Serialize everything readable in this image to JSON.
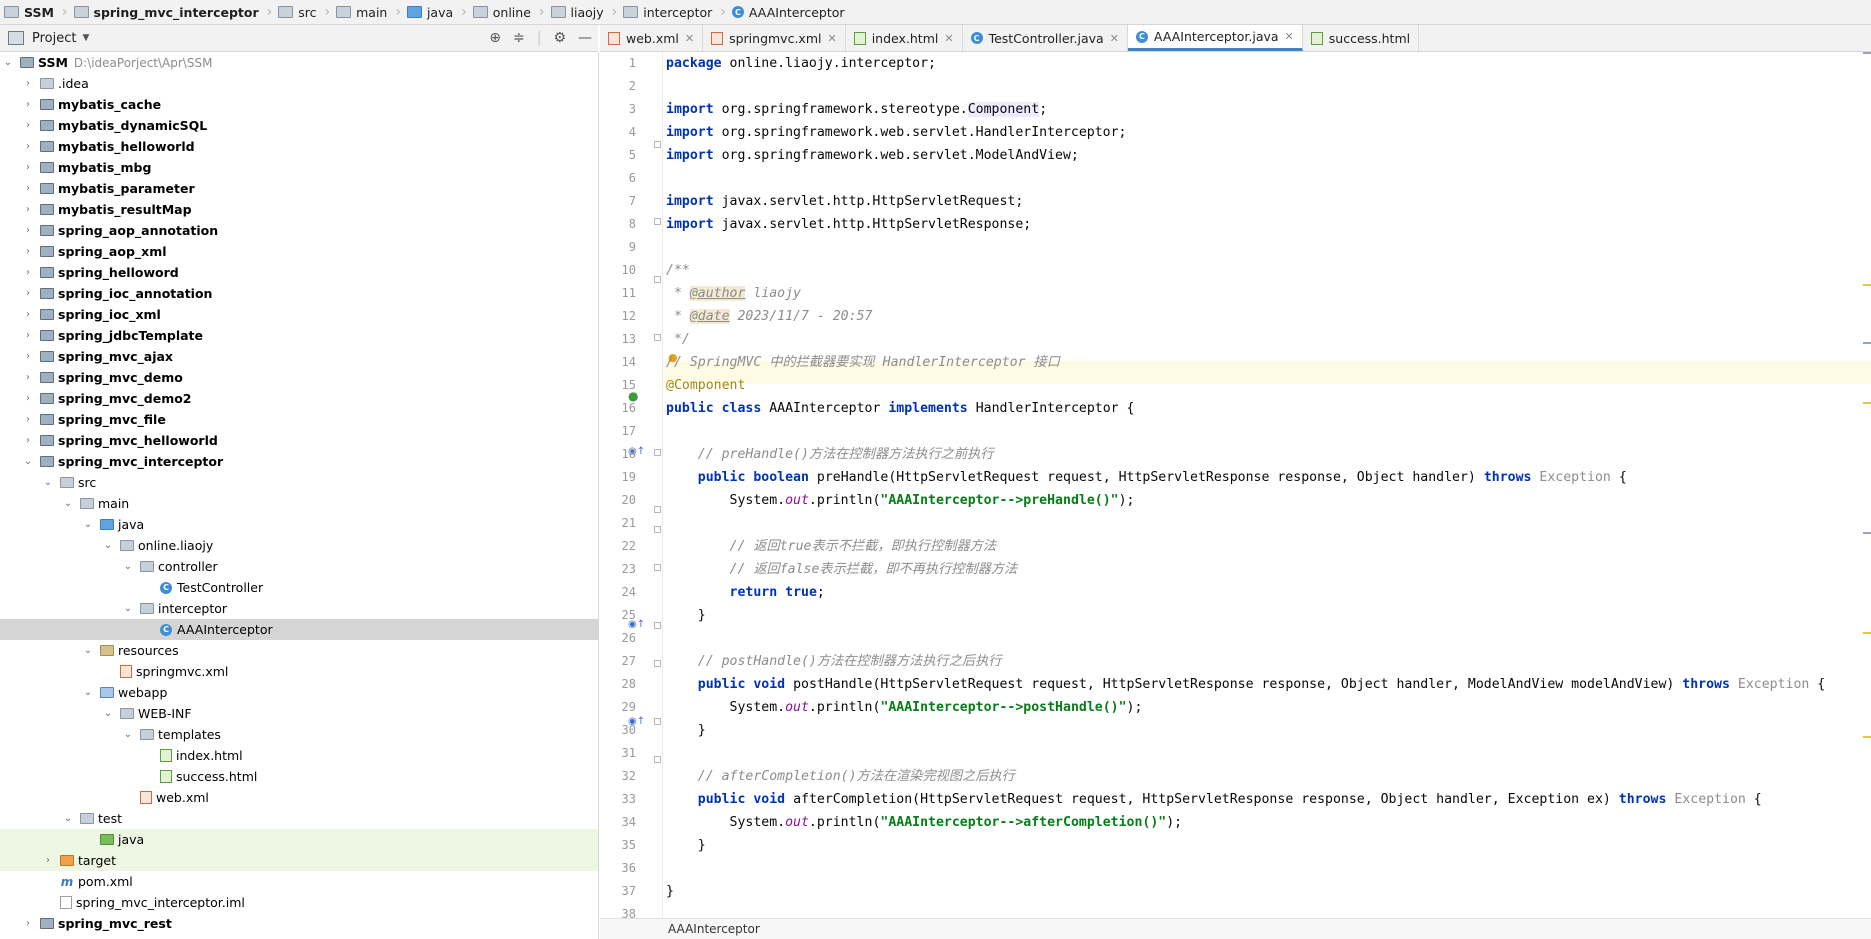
{
  "breadcrumb": [
    "SSM",
    "spring_mvc_interceptor",
    "src",
    "main",
    "java",
    "online",
    "liaojy",
    "interceptor",
    "AAAInterceptor"
  ],
  "project_panel": {
    "title": "Project",
    "root_name": "SSM",
    "root_path": "D:\\ideaPorject\\Apr\\SSM"
  },
  "tree": [
    {
      "label": ".idea",
      "bold": false
    },
    {
      "label": "mybatis_cache",
      "bold": true
    },
    {
      "label": "mybatis_dynamicSQL",
      "bold": true
    },
    {
      "label": "mybatis_helloworld",
      "bold": true
    },
    {
      "label": "mybatis_mbg",
      "bold": true
    },
    {
      "label": "mybatis_parameter",
      "bold": true
    },
    {
      "label": "mybatis_resultMap",
      "bold": true
    },
    {
      "label": "spring_aop_annotation",
      "bold": true
    },
    {
      "label": "spring_aop_xml",
      "bold": true
    },
    {
      "label": "spring_helloword",
      "bold": true
    },
    {
      "label": "spring_ioc_annotation",
      "bold": true
    },
    {
      "label": "spring_ioc_xml",
      "bold": true
    },
    {
      "label": "spring_jdbcTemplate",
      "bold": true
    },
    {
      "label": "spring_mvc_ajax",
      "bold": true
    },
    {
      "label": "spring_mvc_demo",
      "bold": true
    },
    {
      "label": "spring_mvc_demo2",
      "bold": true
    },
    {
      "label": "spring_mvc_file",
      "bold": true
    },
    {
      "label": "spring_mvc_helloworld",
      "bold": true
    },
    {
      "label": "spring_mvc_interceptor",
      "bold": true
    },
    {
      "label": "src",
      "bold": false
    },
    {
      "label": "main",
      "bold": false
    },
    {
      "label": "java",
      "bold": false
    },
    {
      "label": "online.liaojy",
      "bold": false
    },
    {
      "label": "controller",
      "bold": false
    },
    {
      "label": "TestController",
      "bold": false
    },
    {
      "label": "interceptor",
      "bold": false
    },
    {
      "label": "AAAInterceptor",
      "bold": false
    },
    {
      "label": "resources",
      "bold": false
    },
    {
      "label": "springmvc.xml",
      "bold": false
    },
    {
      "label": "webapp",
      "bold": false
    },
    {
      "label": "WEB-INF",
      "bold": false
    },
    {
      "label": "templates",
      "bold": false
    },
    {
      "label": "index.html",
      "bold": false
    },
    {
      "label": "success.html",
      "bold": false
    },
    {
      "label": "web.xml",
      "bold": false
    },
    {
      "label": "test",
      "bold": false
    },
    {
      "label": "java",
      "bold": false
    },
    {
      "label": "target",
      "bold": false
    },
    {
      "label": "pom.xml",
      "bold": false
    },
    {
      "label": "spring_mvc_interceptor.iml",
      "bold": false
    },
    {
      "label": "spring_mvc_rest",
      "bold": true
    }
  ],
  "tabs": [
    {
      "label": "web.xml",
      "active": false
    },
    {
      "label": "springmvc.xml",
      "active": false
    },
    {
      "label": "index.html",
      "active": false
    },
    {
      "label": "TestController.java",
      "active": false
    },
    {
      "label": "AAAInterceptor.java",
      "active": true
    },
    {
      "label": "success.html",
      "active": false
    }
  ],
  "code_lines": [
    "package online.liaojy.interceptor;",
    "",
    "import org.springframework.stereotype.Component;",
    "import org.springframework.web.servlet.HandlerInterceptor;",
    "import org.springframework.web.servlet.ModelAndView;",
    "",
    "import javax.servlet.http.HttpServletRequest;",
    "import javax.servlet.http.HttpServletResponse;",
    "",
    "/**",
    " * @author liaojy",
    " * @date 2023/11/7 - 20:57",
    " */",
    "// SpringMVC 中的拦截器要实现 HandlerInterceptor 接口",
    "@Component",
    "public class AAAInterceptor implements HandlerInterceptor {",
    "",
    "    // preHandle()方法在控制器方法执行之前执行",
    "    public boolean preHandle(HttpServletRequest request, HttpServletResponse response, Object handler) throws Exception {",
    "        System.out.println(\"AAAInterceptor-->preHandle()\");",
    "",
    "        // 返回true表示不拦截，即执行控制器方法",
    "        // 返回false表示拦截，即不再执行控制器方法",
    "        return true;",
    "    }",
    "",
    "    // postHandle()方法在控制器方法执行之后执行",
    "    public void postHandle(HttpServletRequest request, HttpServletResponse response, Object handler, ModelAndView modelAndView) throws Exception {",
    "        System.out.println(\"AAAInterceptor-->postHandle()\");",
    "    }",
    "",
    "    // afterCompletion()方法在渲染完视图之后执行",
    "    public void afterCompletion(HttpServletRequest request, HttpServletResponse response, Object handler, Exception ex) throws Exception {",
    "        System.out.println(\"AAAInterceptor-->afterCompletion()\");",
    "    }",
    "",
    "}",
    ""
  ],
  "line_numbers": [
    "1",
    "2",
    "3",
    "4",
    "5",
    "6",
    "7",
    "8",
    "9",
    "10",
    "11",
    "12",
    "13",
    "14",
    "15",
    "16",
    "17",
    "18",
    "19",
    "20",
    "21",
    "22",
    "23",
    "24",
    "25",
    "26",
    "27",
    "28",
    "29",
    "30",
    "31",
    "32",
    "33",
    "34",
    "35",
    "36",
    "37",
    "38"
  ],
  "footer": {
    "breadcrumb": "AAAInterceptor"
  },
  "colors": {
    "keyword": "#0033b3",
    "string": "#067d17",
    "comment": "#8c8c8c",
    "annotation": "#9e880d",
    "selection": "#d5d5d5",
    "active_tab_underline": "#4083c9"
  }
}
